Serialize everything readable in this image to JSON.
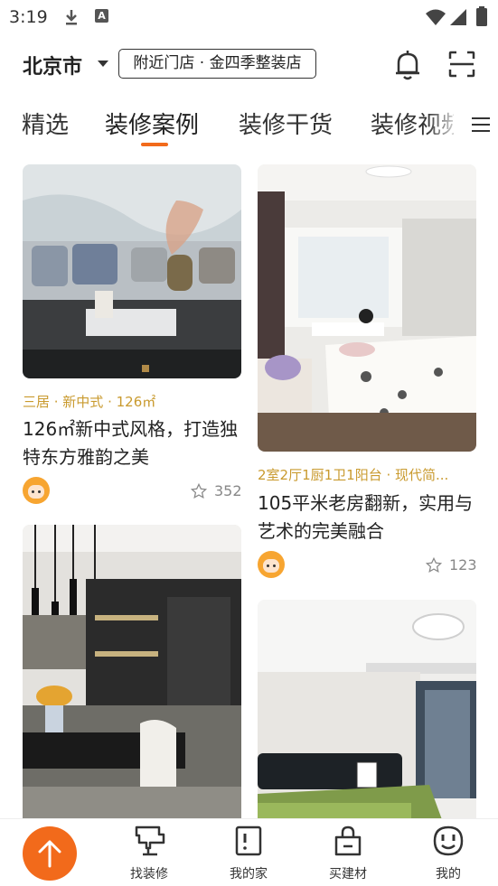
{
  "status_bar": {
    "time": "3:19"
  },
  "header": {
    "city": "北京市",
    "store": "附近门店 · 金四季整装店"
  },
  "tabs": [
    {
      "label": "精选"
    },
    {
      "label": "装修案例"
    },
    {
      "label": "装修干货"
    },
    {
      "label": "装修视频"
    }
  ],
  "cards": [
    {
      "tags": "三居 · 新中式 · 126㎡",
      "title": "126㎡新中式风格，打造独特东方雅韵之美",
      "likes": "352"
    },
    {
      "tags": "2室2厅1厨1卫1阳台 · 现代简...",
      "title": "105平米老房翻新，实用与艺术的完美融合",
      "likes": "123"
    }
  ],
  "bottom_nav": [
    {
      "label": "找装修",
      "icon": "find-decoration-icon"
    },
    {
      "label": "我的家",
      "icon": "my-home-icon"
    },
    {
      "label": "买建材",
      "icon": "shopping-bag-icon"
    },
    {
      "label": "我的",
      "icon": "smile-icon"
    }
  ],
  "colors": {
    "accent": "#f26a1b",
    "tag": "#c99a2e"
  }
}
